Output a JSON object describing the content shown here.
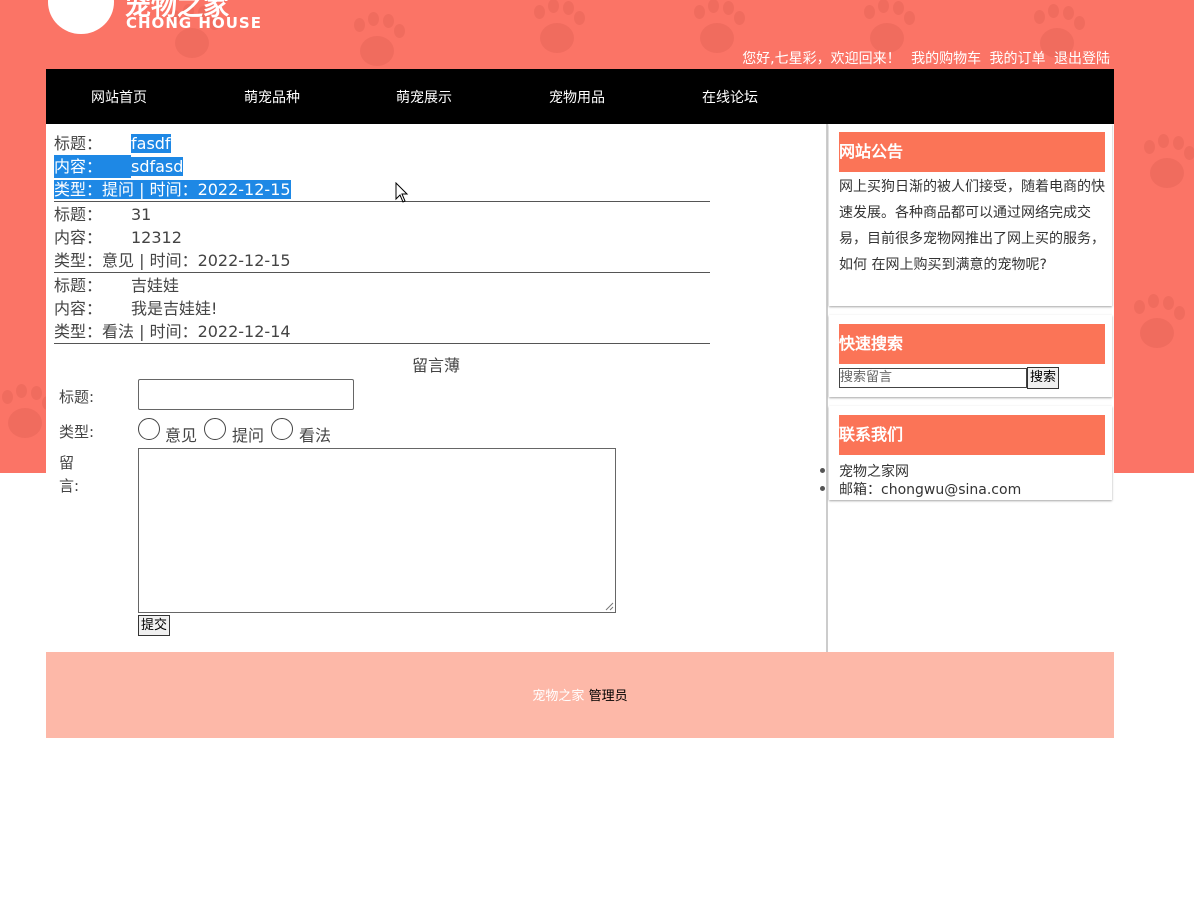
{
  "brand": {
    "name_cn": "宠物之家",
    "name_en": "CHONG HOUSE"
  },
  "top_links": {
    "greeting": "您好,七星彩，欢迎回来！",
    "cart": "我的购物车",
    "orders": "我的订单",
    "logout": "退出登陆"
  },
  "nav": {
    "items": [
      "网站首页",
      "萌宠品种",
      "萌宠展示",
      "宠物用品",
      "在线论坛"
    ]
  },
  "messages": [
    {
      "title_label": "标题：",
      "title": "fasdf",
      "content_label": "内容：",
      "content": "sdfasd",
      "meta": "类型：提问 | 时间：2022-12-15",
      "selected": true
    },
    {
      "title_label": "标题：",
      "title": "31",
      "content_label": "内容：",
      "content": "12312",
      "meta": "类型：意见 | 时间：2022-12-15",
      "selected": false
    },
    {
      "title_label": "标题：",
      "title": "吉娃娃",
      "content_label": "内容：",
      "content": "我是吉娃娃!",
      "meta": "类型：看法 | 时间：2022-12-14",
      "selected": false
    }
  ],
  "form": {
    "heading": "留言薄",
    "title_label": "标题:",
    "title_value": "",
    "type_label": "类型:",
    "type_options": [
      "意见",
      "提问",
      "看法"
    ],
    "message_label_1": "留",
    "message_label_2": "言:",
    "message_value": "",
    "submit_label": "提交"
  },
  "sidebar": {
    "notice": {
      "heading": "网站公告",
      "text": "网上买狗日渐的被人们接受，随着电商的快速发展。各种商品都可以通过网络完成交易，目前很多宠物网推出了网上买的服务，如何 在网上购买到满意的宠物呢?"
    },
    "search": {
      "heading": "快速搜索",
      "placeholder": "搜索留言",
      "button_label": "搜索"
    },
    "contact": {
      "heading": "联系我们",
      "items": [
        "宠物之家网",
        "邮箱：chongwu@sina.com"
      ]
    }
  },
  "footer": {
    "site": "宠物之家",
    "admin": "管理员"
  },
  "colors": {
    "banner": "#fb7466",
    "nav": "#000000",
    "box_head": "#fb7457",
    "footer": "#fdb8a8",
    "selection": "#1e88e5"
  }
}
